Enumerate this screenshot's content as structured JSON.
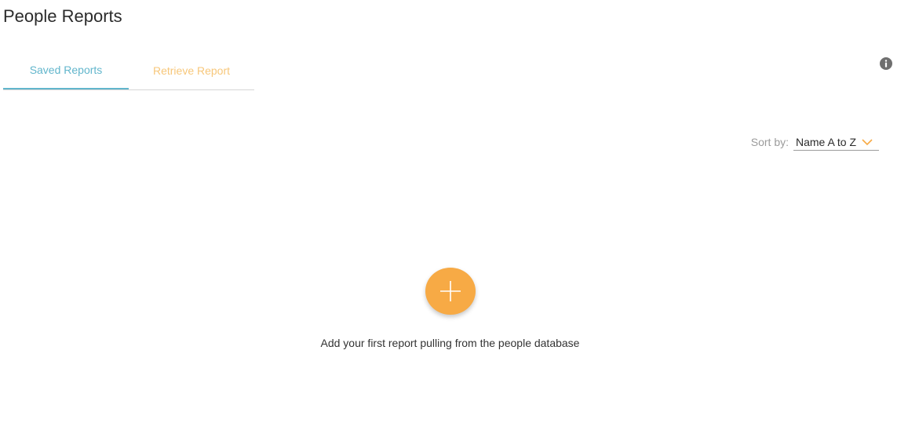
{
  "header": {
    "title": "People Reports"
  },
  "tabs": [
    {
      "label": "Saved Reports",
      "active": true
    },
    {
      "label": "Retrieve Report",
      "active": false
    }
  ],
  "info": {
    "icon": "info-icon"
  },
  "sort": {
    "label": "Sort by:",
    "selected": "Name A to Z"
  },
  "empty_state": {
    "add_icon": "plus-icon",
    "message": "Add your first report pulling from the people database"
  },
  "colors": {
    "accent_blue": "#62b6cc",
    "accent_orange": "#f7aa45",
    "inactive_tab": "#f7c77a"
  }
}
